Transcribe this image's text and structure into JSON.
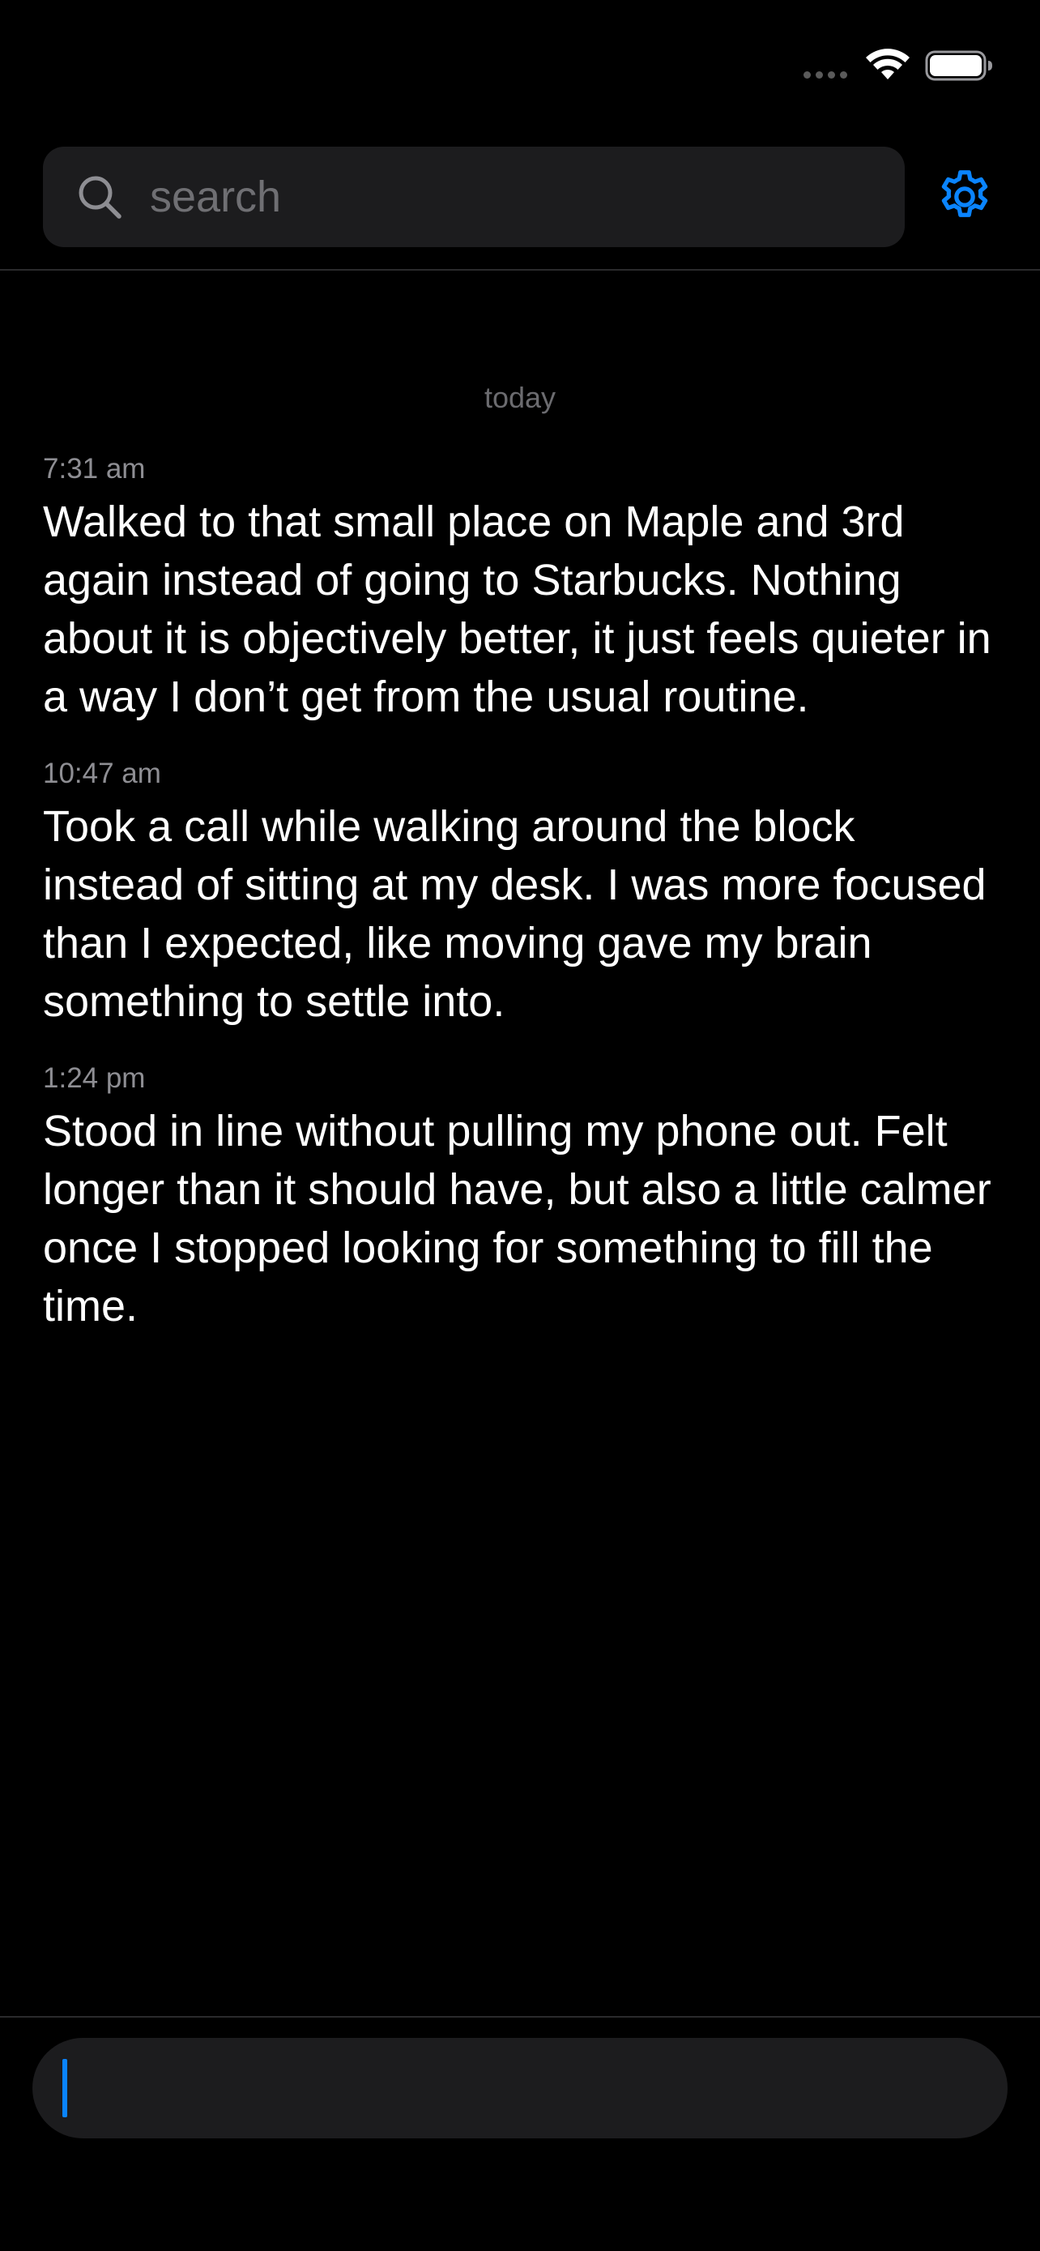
{
  "search": {
    "placeholder": "search",
    "value": ""
  },
  "icons": {
    "search": "search-icon",
    "settings": "gear-icon",
    "wifi": "wifi-icon",
    "battery": "battery-icon",
    "signal": "signal-dots-icon"
  },
  "colors": {
    "accent": "#0a84ff",
    "background": "#000000",
    "field": "#1c1c1e",
    "secondary_text": "#8e8e93"
  },
  "journal": {
    "day_label": "today",
    "entries": [
      {
        "time": "7:31 am",
        "text": "Walked to that small place on Maple and 3rd again instead of going to Starbucks. Nothing about it is objectively better, it just feels quieter in a way I don’t get from the usual routine."
      },
      {
        "time": "10:47 am",
        "text": "Took a call while walking around the block instead of sitting at my desk. I was more focused than I expected, like moving gave my brain something to settle into."
      },
      {
        "time": "1:24 pm",
        "text": "Stood in line without pulling my phone out. Felt longer than it should have, but also a little calmer once I stopped looking for something to fill the time."
      }
    ]
  },
  "compose": {
    "value": ""
  }
}
